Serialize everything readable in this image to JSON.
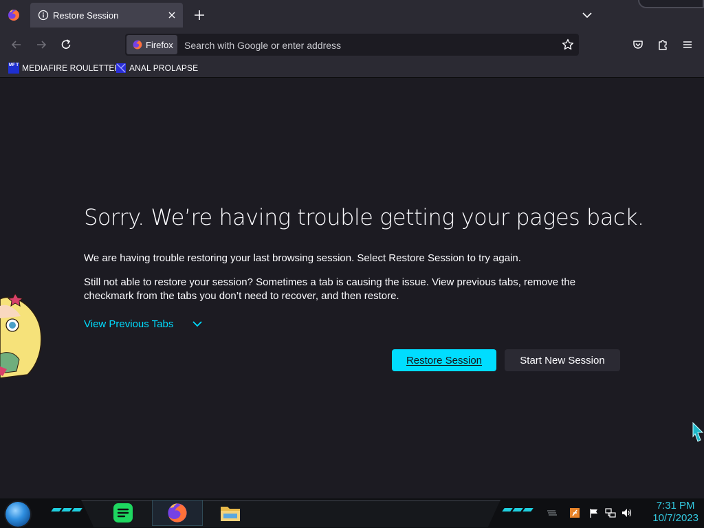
{
  "browser": {
    "tab": {
      "title": "Restore Session"
    },
    "urlbar": {
      "identity_label": "Firefox",
      "placeholder": "Search with Google or enter address"
    },
    "bookmarks": [
      {
        "label": "MEDIAFIRE ROULETTER",
        "icon": "mft-icon",
        "icon_text": "MF T"
      },
      {
        "label": "ANAL PROLAPSE",
        "icon": "bookmark-site-icon"
      }
    ]
  },
  "page": {
    "title": "Sorry. We’re having trouble getting your pages back.",
    "paragraph1": "We are having trouble restoring your last browsing session. Select Restore Session to try again.",
    "paragraph2": "Still not able to restore your session? Sometimes a tab is causing the issue. View previous tabs, remove the checkmark from the tabs you don’t need to recover, and then restore.",
    "view_previous_tabs": "View Previous Tabs",
    "restore_button": "Restore Session",
    "start_new_button": "Start New Session"
  },
  "taskbar": {
    "clock_time": "7:31 PM",
    "clock_date": "10/7/2023"
  },
  "colors": {
    "accent": "#00ddff",
    "background": "#1c1b22",
    "toolbar": "#2b2a33",
    "clock": "#33c9e0"
  }
}
